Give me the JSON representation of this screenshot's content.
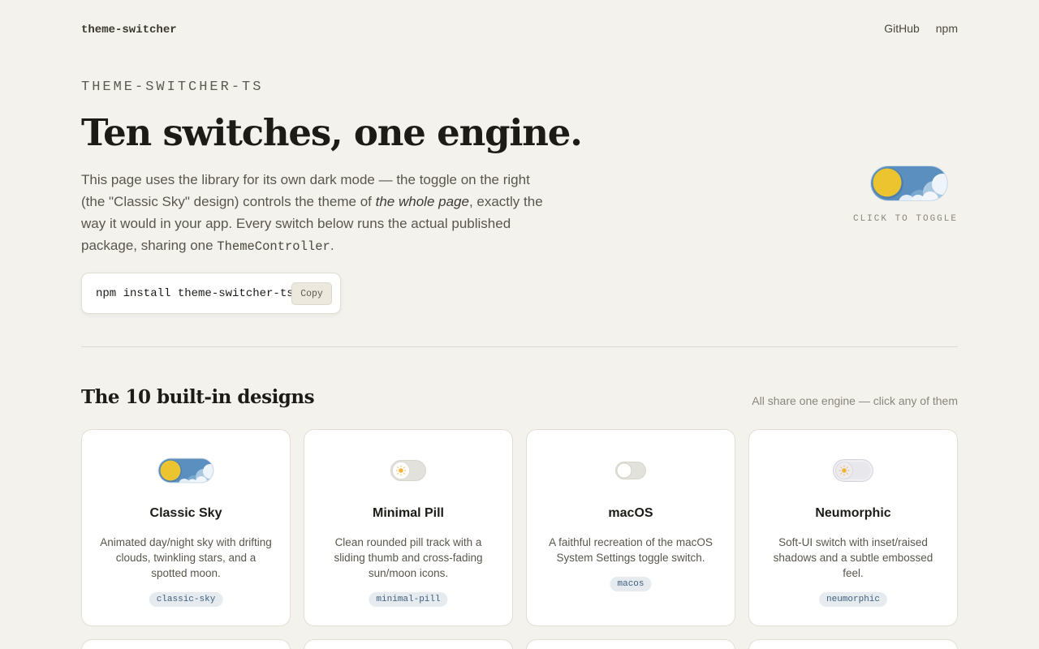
{
  "header": {
    "brand": "theme-switcher",
    "nav": [
      "GitHub",
      "npm"
    ]
  },
  "hero": {
    "eyebrow": "THEME-SWITCHER-TS",
    "title": "Ten switches, one engine.",
    "desc_part1": "This page uses the library for its own dark mode — the toggle on the right (the \"Classic Sky\" design) controls the theme of ",
    "desc_em": "the whole page",
    "desc_part2": ", exactly the way it would in your app. Every switch below runs the actual published package, sharing one ",
    "desc_code": "ThemeController",
    "desc_end": ".",
    "install_cmd": "npm install theme-switcher-ts",
    "copy_label": "Copy",
    "toggle_label": "CLICK TO TOGGLE"
  },
  "designs": {
    "title": "The 10 built-in designs",
    "hint": "All share one engine — click any of them",
    "cards": [
      {
        "name": "Classic Sky",
        "desc": "Animated day/night sky with drifting clouds, twinkling stars, and a spotted moon.",
        "tag": "classic-sky",
        "icon": "classic-sky-toggle-icon"
      },
      {
        "name": "Minimal Pill",
        "desc": "Clean rounded pill track with a sliding thumb and cross-fading sun/moon icons.",
        "tag": "minimal-pill",
        "icon": "minimal-pill-toggle-icon"
      },
      {
        "name": "macOS",
        "desc": "A faithful recreation of the macOS System Settings toggle switch.",
        "tag": "macos",
        "icon": "macos-toggle-icon"
      },
      {
        "name": "Neumorphic",
        "desc": "Soft-UI switch with inset/raised shadows and a subtle embossed feel.",
        "tag": "neumorphic",
        "icon": "neumorphic-toggle-icon"
      }
    ]
  },
  "colors": {
    "background": "#f4f2ed",
    "sky_blue": "#5b8fbf",
    "sun_yellow": "#ecc42f",
    "tag_bg": "#e6ebf0",
    "tag_text": "#3e5f7e"
  }
}
